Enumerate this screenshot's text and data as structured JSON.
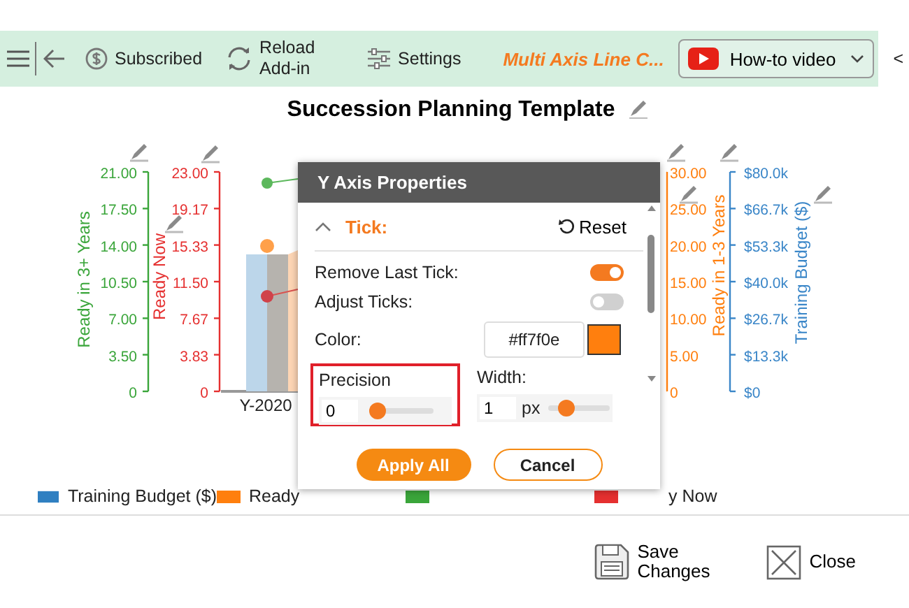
{
  "toolbar": {
    "buttons": [
      {
        "kind": "subscribed",
        "label": "Subscribed"
      },
      {
        "kind": "reload",
        "label": "Reload Add-in"
      },
      {
        "kind": "settings",
        "label": "Settings"
      }
    ],
    "app_title": "Multi Axis Line C...",
    "video_button": "How-to video",
    "collapse": "<"
  },
  "chart": {
    "title": "Succession Planning Template",
    "category": "Y-2020",
    "left_axes": [
      {
        "title": "Ready in 3+ Years",
        "color": "#3aa53a",
        "ticks": [
          "21.00",
          "17.50",
          "14.00",
          "10.50",
          "7.00",
          "3.50",
          "0"
        ]
      },
      {
        "title": "Ready Now",
        "color": "#e53030",
        "ticks": [
          "23.00",
          "19.17",
          "15.33",
          "11.50",
          "7.67",
          "3.83",
          "0"
        ]
      }
    ],
    "right_axes": [
      {
        "title": "Ready in 1-3 Years",
        "color": "#ff7f0e",
        "ticks": [
          "30.00",
          "25.00",
          "20.00",
          "15.00",
          "10.00",
          "5.00",
          "0"
        ]
      },
      {
        "title": "Training Budget ($)",
        "color": "#3a86c8",
        "ticks": [
          "$80.0k",
          "$66.7k",
          "$53.3k",
          "$40.0k",
          "$26.7k",
          "$13.3k",
          "$0"
        ]
      }
    ],
    "legend": [
      {
        "label": "Training Budget ($)",
        "color": "#2f7fc1"
      },
      {
        "label": "Ready",
        "color": "#ff7f0e"
      },
      {
        "color": "#3aa53a"
      },
      {
        "label": "y Now",
        "color": "#e53030"
      }
    ]
  },
  "dialog": {
    "title": "Y Axis Properties",
    "section": {
      "title": "Tick:",
      "expanded": true,
      "reset": "Reset"
    },
    "toggles": [
      {
        "label": "Remove Last Tick:",
        "on": true
      },
      {
        "label": "Adjust Ticks:",
        "on": false
      }
    ],
    "color": {
      "label": "Color:",
      "value": "#ff7f0e"
    },
    "precision": {
      "label": "Precision",
      "value": "0",
      "level": 0,
      "highlighted": true
    },
    "width": {
      "label": "Width:",
      "value": "1",
      "unit": "px",
      "level": 0.2
    },
    "buttons": [
      {
        "kind": "primary",
        "label": "Apply All"
      },
      {
        "kind": "secondary",
        "label": "Cancel"
      }
    ]
  },
  "footer": {
    "buttons": [
      {
        "kind": "save",
        "label": "Save Changes"
      },
      {
        "kind": "close",
        "label": "Close"
      }
    ]
  }
}
